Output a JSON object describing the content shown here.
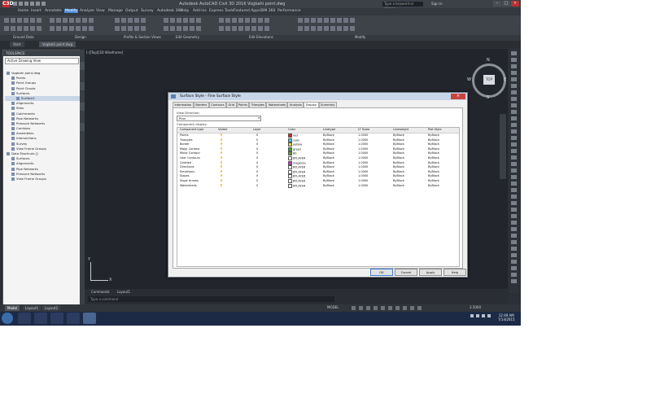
{
  "app": {
    "title": "Autodesk AutoCAD Civil 3D 2016   Vogbahi point.dwg",
    "search_placeholder": "Type a keyword or phrase",
    "sign_in": "Sign In",
    "app_logo": "C3D"
  },
  "menu_tabs": [
    "Home",
    "Insert",
    "Annotate",
    "Modify",
    "Analyze",
    "View",
    "Manage",
    "Output",
    "Survey",
    "Autodesk 360",
    "Help",
    "Add-ins",
    "Express Tools",
    "Featured Apps",
    "BIM 360",
    "Performance"
  ],
  "ribbon_panels": [
    "Ground Data",
    "Design",
    "Profile & Section Views",
    "Edit Geometry",
    "Edit Elevations",
    "Modify"
  ],
  "doc_tabs": [
    "Start",
    "Vogbahi point.dwg"
  ],
  "toolspace": {
    "title": "TOOLSPACE",
    "view_select": "Active Drawing View",
    "tree": [
      {
        "label": "Vogbahi point.dwg",
        "level": 0
      },
      {
        "label": "Points",
        "level": 1
      },
      {
        "label": "Point Groups",
        "level": 1
      },
      {
        "label": "Point Clouds",
        "level": 1
      },
      {
        "label": "Surfaces",
        "level": 1
      },
      {
        "label": "Surface1",
        "level": 2
      },
      {
        "label": "Alignments",
        "level": 1
      },
      {
        "label": "Sites",
        "level": 1
      },
      {
        "label": "Catchments",
        "level": 1
      },
      {
        "label": "Pipe Networks",
        "level": 1
      },
      {
        "label": "Pressure Networks",
        "level": 1
      },
      {
        "label": "Corridors",
        "level": 1
      },
      {
        "label": "Assemblies",
        "level": 1
      },
      {
        "label": "Intersections",
        "level": 1
      },
      {
        "label": "Survey",
        "level": 1
      },
      {
        "label": "View Frame Groups",
        "level": 1
      },
      {
        "label": "Data Shortcuts []",
        "level": 0
      },
      {
        "label": "Surfaces",
        "level": 1
      },
      {
        "label": "Alignments",
        "level": 1
      },
      {
        "label": "Pipe Networks",
        "level": 1
      },
      {
        "label": "Pressure Networks",
        "level": 1
      },
      {
        "label": "View Frame Groups",
        "level": 1
      }
    ],
    "selected_index": 5
  },
  "viewport_label": "[-][Top][2D Wireframe]",
  "viewcube": {
    "face": "TOP",
    "n": "N",
    "s": "S",
    "e": "E",
    "w": "W",
    "wcs": "WCS"
  },
  "ucs": {
    "x": "X",
    "y": "Y"
  },
  "command": {
    "tabs": [
      "Commands",
      "Layout1"
    ],
    "placeholder": "Type a command"
  },
  "layout_tabs": [
    "Model",
    "Layout1",
    "Layout2"
  ],
  "status": {
    "model": "MODEL",
    "scale": "1:1000",
    "coords": "3.5000"
  },
  "dialog": {
    "title": "Surface Style - Fine Surface Style",
    "tabs": [
      "Information",
      "Borders",
      "Contours",
      "Grid",
      "Points",
      "Triangles",
      "Watersheds",
      "Analysis",
      "Display",
      "Summary"
    ],
    "active_tab": 8,
    "view_direction_label": "View Direction:",
    "view_direction_value": "Plan",
    "component_display_label": "Component display:",
    "columns": [
      "Component type",
      "Visible",
      "Layer",
      "Color",
      "Linetype",
      "LT Scale",
      "Lineweight",
      "Plot Style"
    ],
    "rows": [
      {
        "type": "Points",
        "layer": "0",
        "color": "red",
        "color_hex": "#e02020",
        "linetype": "ByBlock",
        "lt_scale": "1.0000",
        "lineweight": "ByBlock",
        "plot": "ByBlock"
      },
      {
        "type": "Triangles",
        "layer": "0",
        "color": "cyan",
        "color_hex": "#30d0e0",
        "linetype": "ByBlock",
        "lt_scale": "1.0000",
        "lineweight": "ByBlock",
        "plot": "ByBlock"
      },
      {
        "type": "Border",
        "layer": "0",
        "color": "yellow",
        "color_hex": "#e8e030",
        "linetype": "ByBlock",
        "lt_scale": "1.0000",
        "lineweight": "ByBlock",
        "plot": "ByBlock"
      },
      {
        "type": "Major Contour",
        "layer": "0",
        "color": "green",
        "color_hex": "#30b030",
        "linetype": "ByBlock",
        "lt_scale": "1.0000",
        "lineweight": "ByBlock",
        "plot": "ByBlock"
      },
      {
        "type": "Minor Contour",
        "layer": "0",
        "color": "80",
        "color_hex": "#6a9a20",
        "linetype": "ByBlock",
        "lt_scale": "1.0000",
        "lineweight": "ByBlock",
        "plot": "ByBlock"
      },
      {
        "type": "User Contours",
        "layer": "0",
        "color": "BYLAYER",
        "color_hex": "#ffffff",
        "linetype": "ByBlock",
        "lt_scale": "1.0000",
        "lineweight": "ByBlock",
        "plot": "ByBlock"
      },
      {
        "type": "Gridded",
        "layer": "0",
        "color": "magenta",
        "color_hex": "#d030c0",
        "linetype": "ByBlock",
        "lt_scale": "1.0000",
        "lineweight": "ByBlock",
        "plot": "ByBlock"
      },
      {
        "type": "Directions",
        "layer": "0",
        "color": "BYLAYER",
        "color_hex": "#ffffff",
        "linetype": "ByBlock",
        "lt_scale": "1.0000",
        "lineweight": "ByBlock",
        "plot": "ByBlock"
      },
      {
        "type": "Elevations",
        "layer": "0",
        "color": "BYLAYER",
        "color_hex": "#ffffff",
        "linetype": "ByBlock",
        "lt_scale": "1.0000",
        "lineweight": "ByBlock",
        "plot": "ByBlock"
      },
      {
        "type": "Slopes",
        "layer": "0",
        "color": "BYLAYER",
        "color_hex": "#ffffff",
        "linetype": "ByBlock",
        "lt_scale": "1.0000",
        "lineweight": "ByBlock",
        "plot": "ByBlock"
      },
      {
        "type": "Slope Arrows",
        "layer": "0",
        "color": "BYLAYER",
        "color_hex": "#ffffff",
        "linetype": "ByBlock",
        "lt_scale": "1.0000",
        "lineweight": "ByBlock",
        "plot": "ByBlock"
      },
      {
        "type": "Watersheds",
        "layer": "0",
        "color": "BYLAYER",
        "color_hex": "#ffffff",
        "linetype": "ByBlock",
        "lt_scale": "1.0000",
        "lineweight": "ByBlock",
        "plot": "ByBlock"
      }
    ],
    "buttons": {
      "ok": "OK",
      "cancel": "Cancel",
      "apply": "Apply",
      "help": "Help"
    }
  },
  "taskbar": {
    "time": "12:49 AM",
    "date": "7/14/2015"
  }
}
